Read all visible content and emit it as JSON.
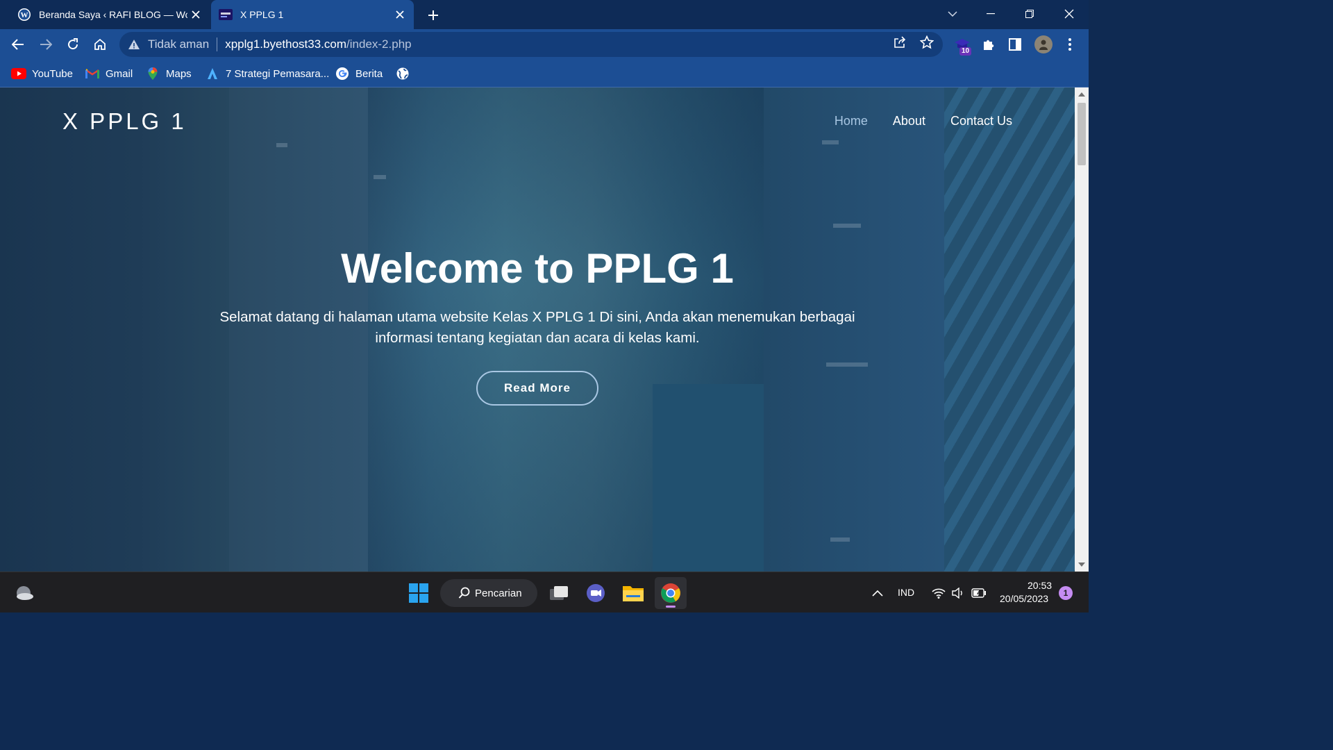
{
  "browser": {
    "tabs": [
      {
        "title": "Beranda Saya ‹ RAFI BLOG — WordPress",
        "active": false,
        "favicon": "wordpress-icon"
      },
      {
        "title": "X PPLG 1",
        "active": true,
        "favicon": "site-icon"
      }
    ],
    "omnibox": {
      "security_label": "Tidak aman",
      "host": "xpplg1.byethost33.com",
      "path": "/index-2.php"
    },
    "extension_badge": "10",
    "bookmarks": [
      {
        "label": "YouTube",
        "icon": "youtube-icon"
      },
      {
        "label": "Gmail",
        "icon": "gmail-icon"
      },
      {
        "label": "Maps",
        "icon": "maps-icon"
      },
      {
        "label": "7 Strategi Pemasara...",
        "icon": "bookmark-a-icon"
      },
      {
        "label": "Berita",
        "icon": "google-icon"
      },
      {
        "label": "",
        "icon": "globe-icon"
      }
    ]
  },
  "site": {
    "logo": "X PPLG 1",
    "nav": [
      {
        "label": "Home",
        "active": true
      },
      {
        "label": "About",
        "active": false
      },
      {
        "label": "Contact Us",
        "active": false
      }
    ],
    "hero": {
      "title": "Welcome to PPLG 1",
      "text": "Selamat datang di halaman utama website Kelas X PPLG 1 Di sini, Anda akan menemukan berbagai informasi tentang kegiatan dan acara di kelas kami.",
      "button": "Read More"
    }
  },
  "taskbar": {
    "search_label": "Pencarian",
    "language": "IND",
    "time": "20:53",
    "date": "20/05/2023",
    "notification_count": "1"
  },
  "colors": {
    "chrome_dark": "#0e2b57",
    "chrome": "#1c4e94",
    "nav_active": "#a9c7e3"
  }
}
